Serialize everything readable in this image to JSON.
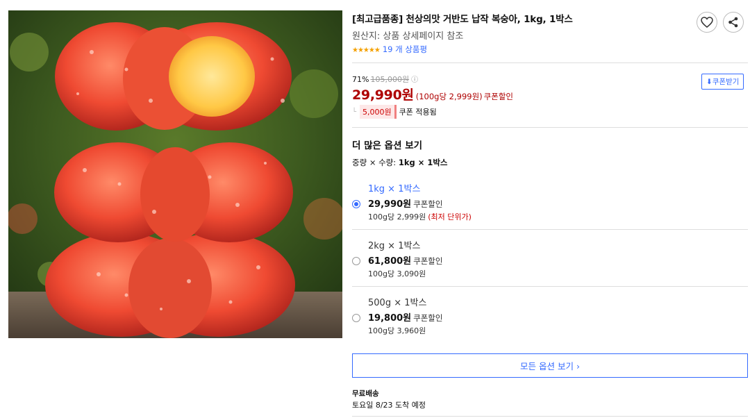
{
  "product": {
    "title": "[최고급품종] 천상의맛 거반도 납작 복숭아, 1kg, 1박스",
    "origin": "원산지: 상품 상세페이지 참조",
    "stars": "★★★★★",
    "review_count": "19 개 상품평",
    "image_icon": "flat-peach-photo"
  },
  "actions": {
    "wishlist_icon": "heart-icon",
    "share_icon": "share-icon"
  },
  "pricing": {
    "discount_rate": "71%",
    "original_price": "105,000원",
    "info_icon": "ⓘ",
    "coupon_button": "⬇쿠폰받기",
    "sale_price": "29,990원",
    "unit_price": "(100g당 2,999원)",
    "coupon_label": "쿠폰할인",
    "coupon_amount": "5,000원",
    "coupon_applied": "쿠폰 적용됨",
    "accent_color": "#ae0000"
  },
  "options": {
    "title": "더 많은 옵션 보기",
    "summary_label": "중량 × 수량:",
    "summary_value": "1kg × 1박스",
    "items": [
      {
        "name": "1kg × 1박스",
        "price": "29,990원",
        "coupon": "쿠폰할인",
        "unit": "100g당 2,999원",
        "note": "(최저 단위가)",
        "selected": true
      },
      {
        "name": "2kg × 1박스",
        "price": "61,800원",
        "coupon": "쿠폰할인",
        "unit": "100g당 3,090원",
        "note": "",
        "selected": false
      },
      {
        "name": "500g × 1박스",
        "price": "19,800원",
        "coupon": "쿠폰할인",
        "unit": "100g당 3,960원",
        "note": "",
        "selected": false
      }
    ],
    "all_button": "모든 옵션 보기 ›"
  },
  "shipping": {
    "title": "무료배송",
    "arrival": "토요일 8/23 도착 예정"
  },
  "colors": {
    "link_blue": "#346aff",
    "price_red": "#ae0000"
  }
}
